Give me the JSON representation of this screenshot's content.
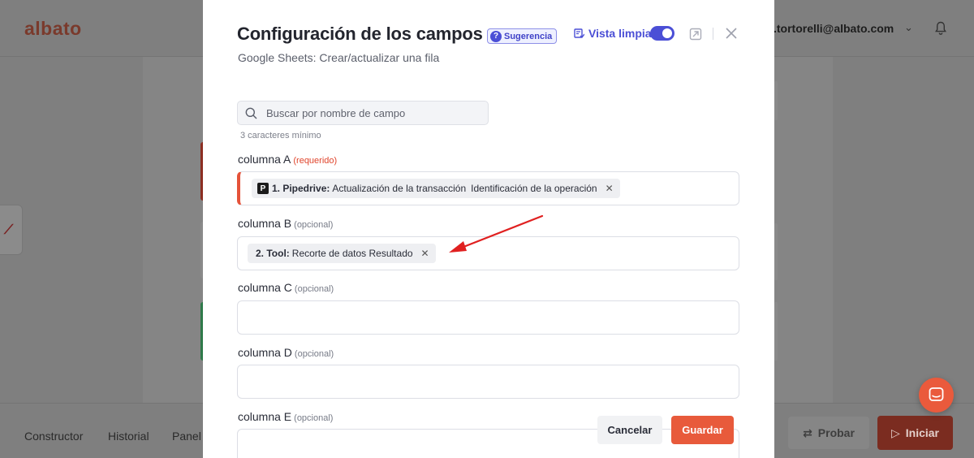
{
  "app": {
    "logo": "albato",
    "user_email": ".tortorelli@albato.com",
    "bottom_nav": [
      "Constructor",
      "Historial",
      "Panel"
    ],
    "probar_label": "Probar",
    "iniciar_label": "Iniciar"
  },
  "modal": {
    "title": "Configuración de los campos",
    "hint_badge": "Sugerencia",
    "clean_view_label": "Vista limpia",
    "subtitle": "Google Sheets: Crear/actualizar una fila",
    "search": {
      "placeholder": "Buscar por nombre de campo",
      "hint": "3 caracteres mínimo"
    },
    "fields": [
      {
        "label": "columna A",
        "tag": "(requerido)",
        "chip": {
          "source_icon": "P",
          "prefix": "1. Pipedrive:",
          "text": "Actualización de la transacción",
          "sub": "Identificación de la operación"
        }
      },
      {
        "label": "columna B",
        "tag": "(opcional)",
        "chip": {
          "prefix": "2. Tool:",
          "text": "Recorte de datos Resultado"
        }
      },
      {
        "label": "columna C",
        "tag": "(opcional)"
      },
      {
        "label": "columna D",
        "tag": "(opcional)"
      },
      {
        "label": "columna E",
        "tag": "(opcional)"
      }
    ],
    "cancel_label": "Cancelar",
    "save_label": "Guardar"
  },
  "colors": {
    "accent": "#4b4fd6",
    "brand": "#e85a3b",
    "required": "#e0452c",
    "annotation_arrow": "#e02020"
  },
  "icons": [
    "search-icon",
    "toggle-switch",
    "expand-icon",
    "close-icon",
    "chip-remove-icon",
    "bell-icon",
    "chevron-down-icon",
    "chat-icon"
  ]
}
